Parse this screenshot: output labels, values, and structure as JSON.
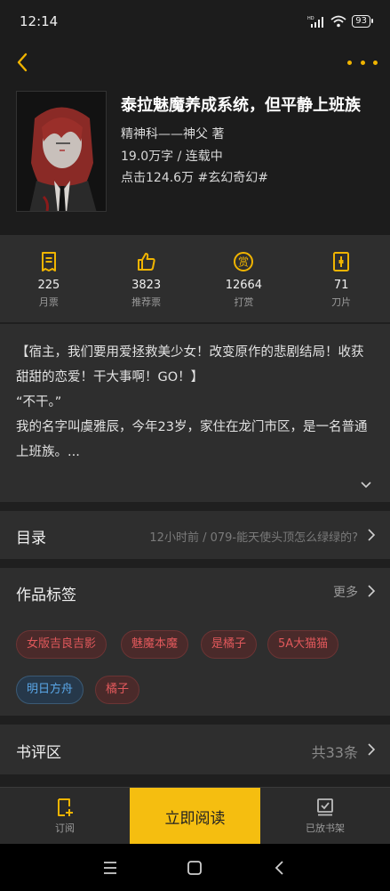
{
  "status": {
    "time": "12:14",
    "battery": "93"
  },
  "book": {
    "title": "泰拉魅魔养成系统，但平静上班族",
    "author": "精神科——神父 著",
    "words": "19.0万字 / 连载中",
    "clicks": "点击124.6万 #玄幻奇幻#"
  },
  "stats": [
    {
      "value": "225",
      "label": "月票",
      "icon": "ticket-icon"
    },
    {
      "value": "3823",
      "label": "推荐票",
      "icon": "thumbs-up-icon"
    },
    {
      "value": "12664",
      "label": "打赏",
      "icon": "reward-coin-icon"
    },
    {
      "value": "71",
      "label": "刀片",
      "icon": "blade-icon"
    }
  ],
  "synopsis": {
    "line1": "【宿主，我们要用爱拯救美少女！改变原作的悲剧结局！收获甜甜的恋爱！干大事啊！GO！】",
    "line2": "“不干。”",
    "line3": "我的名字叫虞雅辰，今年23岁，家住在龙门市区，是一名普通上班族。..."
  },
  "toc": {
    "title": "目录",
    "latest": "12小时前 / 079-能天使头顶怎么绿绿的?"
  },
  "tags_section": {
    "title": "作品标签",
    "more": "更多",
    "tags": [
      {
        "label": "女版吉良吉影",
        "color": "red"
      },
      {
        "label": "魅魔本魔",
        "color": "red"
      },
      {
        "label": "是橘子",
        "color": "red"
      },
      {
        "label": "5A大猫猫",
        "color": "red"
      },
      {
        "label": "明日方舟",
        "color": "blue"
      },
      {
        "label": "橘子",
        "color": "red"
      }
    ]
  },
  "reviews": {
    "title": "书评区",
    "count": "共33条"
  },
  "bottom": {
    "subscribe": "订阅",
    "read": "立即阅读",
    "shelf": "已放书架"
  },
  "colors": {
    "accent": "#f5be10",
    "tag_red": "#e0585b",
    "tag_blue": "#5aa7e8"
  }
}
